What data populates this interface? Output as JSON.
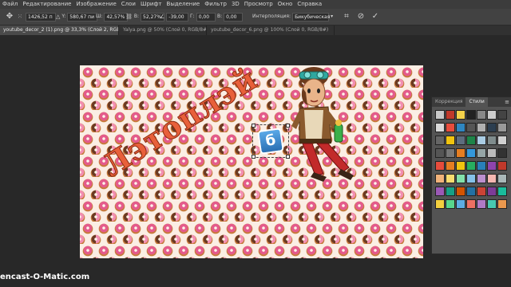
{
  "menu": [
    "Файл",
    "Редактирование",
    "Изображение",
    "Слои",
    "Шрифт",
    "Выделение",
    "Фильтр",
    "3D",
    "Просмотр",
    "Окно",
    "Справка"
  ],
  "options": {
    "x_value": "1426,52 п",
    "y_label": "Y:",
    "y_value": "580,67 пи",
    "w_label": "Ш:",
    "w_value": "42,57%",
    "h_label": "В:",
    "h_value": "52,27%",
    "angle_value": "-39,00",
    "hskew_label": "Г:",
    "hskew_value": "0,00",
    "vskew_label": "В:",
    "vskew_value": "0,00",
    "interp_label": "Интерполяция:",
    "interp_value": "Бикубическая"
  },
  "tabs": [
    {
      "label": "youtube_decor_2 (1).png @ 33,3% (Слой 2, RGB/8#) *",
      "active": true
    },
    {
      "label": "Yalya.png @ 50% (Слой 0, RGB/8#)",
      "active": false
    },
    {
      "label": "youtube_decor_6.png @ 100% (Слой 0, RGB/8#)",
      "active": false
    }
  ],
  "canvas": {
    "title_text": "Лэтоплэй",
    "logo_letter": "б"
  },
  "styles_panel": {
    "tab_corrections": "Коррекция",
    "tab_styles": "Стили",
    "menu_icon": "≡"
  },
  "watermark": "encast-O-Matic.com",
  "colors": {
    "bg": "#282828",
    "menubar": "#3c3c3c",
    "panel": "#535353",
    "accent_title": "#e8603a"
  }
}
